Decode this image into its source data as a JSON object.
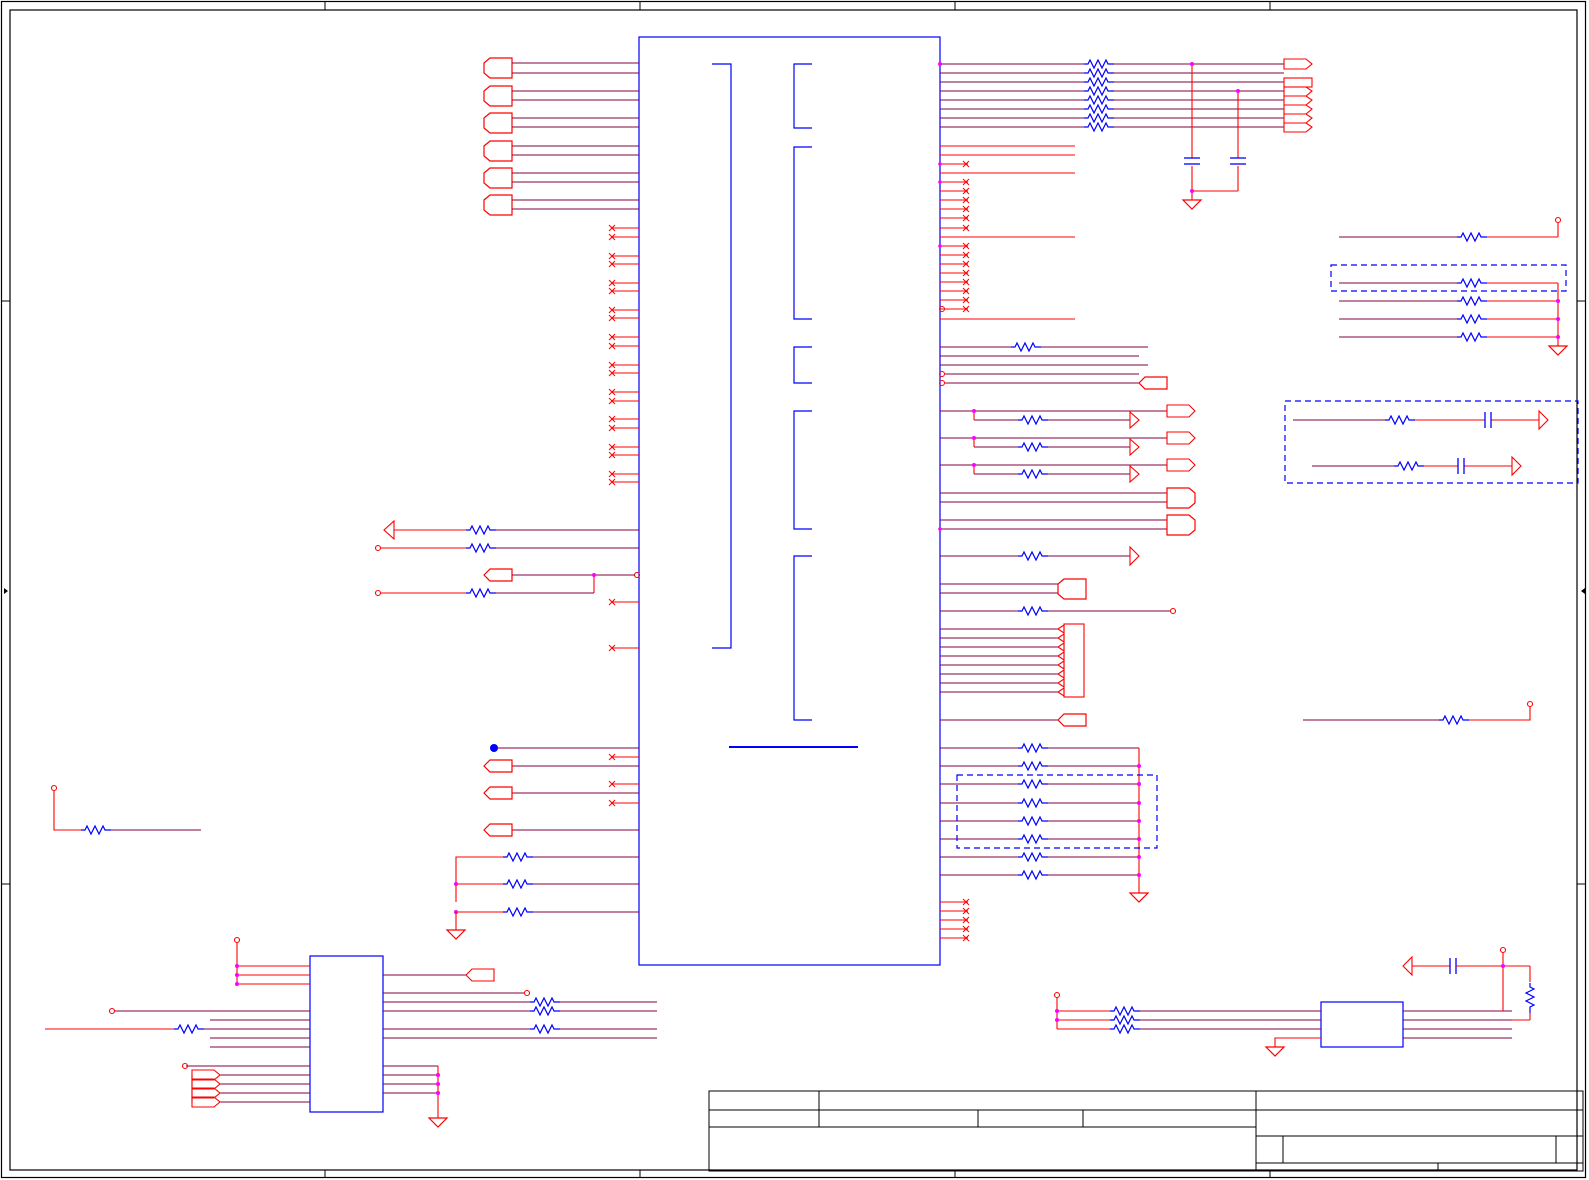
{
  "sheet": {
    "zone_columns": [
      "",
      "",
      "",
      "",
      ""
    ],
    "zone_rows": [
      "",
      "",
      ""
    ],
    "title_block": {
      "company": "",
      "project": "",
      "title": "",
      "document_number": "",
      "revision": "",
      "date": "",
      "sheet": ""
    }
  },
  "colors": {
    "wire": "#ff0000",
    "net": "#800040",
    "component": "#0000ff",
    "junction": "#ff00ff",
    "frame": "#000000",
    "group_box": "#0000ff"
  },
  "components": {
    "main_ic": {
      "designator": "",
      "value": ""
    },
    "lower_left_ic": {
      "designator": "",
      "value": ""
    },
    "lower_right_ic": {
      "designator": "",
      "value": ""
    }
  },
  "icons": [
    "resistor-icon",
    "capacitor-icon",
    "ground-icon",
    "power-port-icon",
    "offpage-connector-icon",
    "no-connect-icon",
    "junction-dot-icon"
  ]
}
